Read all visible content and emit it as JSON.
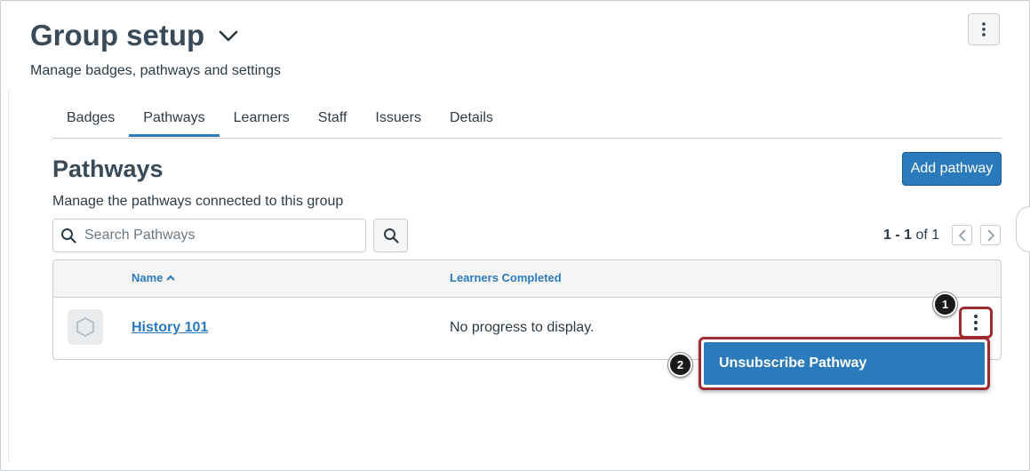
{
  "header": {
    "title": "Group setup",
    "subtitle": "Manage badges, pathways and settings"
  },
  "tabs": [
    {
      "label": "Badges",
      "active": false
    },
    {
      "label": "Pathways",
      "active": true
    },
    {
      "label": "Learners",
      "active": false
    },
    {
      "label": "Staff",
      "active": false
    },
    {
      "label": "Issuers",
      "active": false
    },
    {
      "label": "Details",
      "active": false
    }
  ],
  "section": {
    "title": "Pathways",
    "description": "Manage the pathways connected to this group",
    "add_button_label": "Add pathway"
  },
  "search": {
    "placeholder": "Search Pathways",
    "value": ""
  },
  "pagination": {
    "range": "1 - 1",
    "of_label": "of",
    "total": "1"
  },
  "table": {
    "columns": [
      {
        "label": "Name",
        "sorted": "ascending"
      },
      {
        "label": "Learners Completed"
      }
    ],
    "rows": [
      {
        "name": "History 101",
        "progress": "No progress to display."
      }
    ]
  },
  "row_menu": {
    "items": [
      {
        "label": "Unsubscribe Pathway"
      }
    ]
  },
  "callouts": [
    "1",
    "2"
  ],
  "colors": {
    "accent": "#2b7abc",
    "highlight": "#a02a32",
    "heading": "#394b58",
    "text": "#2d3b45"
  }
}
